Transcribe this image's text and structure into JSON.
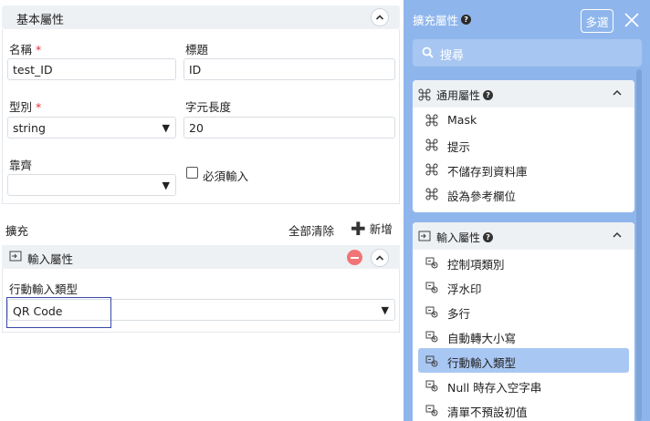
{
  "basic": {
    "title": "基本屬性",
    "name_label": "名稱",
    "name_value": "test_ID",
    "title_label": "標題",
    "title_value": "ID",
    "type_label": "型別",
    "type_value": "string",
    "length_label": "字元長度",
    "length_value": "20",
    "align_label": "靠齊",
    "align_value": "",
    "required_label": "必須輸入",
    "required_checked": false,
    "required_mark": "*"
  },
  "extension": {
    "label": "擴充",
    "clear_all": "全部清除",
    "add_new": "新增",
    "plus": "✚",
    "input_section_title": "輸入屬性",
    "mobile_type_label": "行動輸入類型",
    "mobile_type_value": "QR Code"
  },
  "panel": {
    "title": "擴充屬性",
    "multi_select": "多選",
    "search_placeholder": "搜尋",
    "groups": [
      {
        "title": "通用屬性",
        "icon": "command-icon",
        "items": [
          "Mask",
          "提示",
          "不儲存到資料庫",
          "設為參考欄位"
        ]
      },
      {
        "title": "輸入屬性",
        "icon": "input-icon",
        "items": [
          "控制項類別",
          "浮水印",
          "多行",
          "自動轉大小寫",
          "行動輸入類型",
          "Null 時存入空字串",
          "清單不預設初值"
        ],
        "active": "行動輸入類型"
      }
    ]
  },
  "colors": {
    "panel_bg": "#8fb6ec",
    "header_bg": "#eef1f4",
    "active_item": "#a9c7f3",
    "remove": "#f17575"
  }
}
